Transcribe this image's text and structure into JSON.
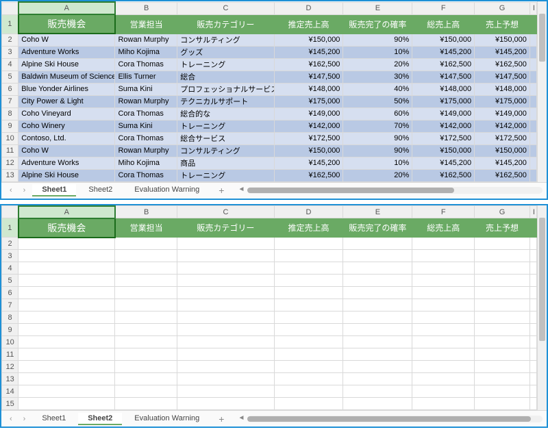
{
  "columns": [
    "A",
    "B",
    "C",
    "D",
    "E",
    "F",
    "G",
    "I"
  ],
  "headers": {
    "A": "販売機会",
    "B": "営業担当",
    "C": "販売カテゴリー",
    "D": "推定売上高",
    "E": "販売完了の確率",
    "F": "総売上高",
    "G": "売上予想"
  },
  "rows": [
    {
      "n": 2,
      "a": "Coho W",
      "b": "Rowan Murphy",
      "c": "コンサルティング",
      "d": "¥150,000",
      "e": "90%",
      "f": "¥150,000",
      "g": "¥150,000"
    },
    {
      "n": 3,
      "a": "Adventure Works",
      "b": "Miho Kojima",
      "c": "グッズ",
      "d": "¥145,200",
      "e": "10%",
      "f": "¥145,200",
      "g": "¥145,200"
    },
    {
      "n": 4,
      "a": "Alpine Ski House",
      "b": "Cora Thomas",
      "c": "トレーニング",
      "d": "¥162,500",
      "e": "20%",
      "f": "¥162,500",
      "g": "¥162,500"
    },
    {
      "n": 5,
      "a": "Baldwin Museum of Science",
      "b": "Ellis Turner",
      "c": "総合",
      "d": "¥147,500",
      "e": "30%",
      "f": "¥147,500",
      "g": "¥147,500"
    },
    {
      "n": 6,
      "a": "Blue Yonder Airlines",
      "b": "Suma Kini",
      "c": "プロフェッショナルサービス",
      "d": "¥148,000",
      "e": "40%",
      "f": "¥148,000",
      "g": "¥148,000"
    },
    {
      "n": 7,
      "a": "City Power & Light",
      "b": "Rowan Murphy",
      "c": "テクニカルサポート",
      "d": "¥175,000",
      "e": "50%",
      "f": "¥175,000",
      "g": "¥175,000"
    },
    {
      "n": 8,
      "a": "Coho Vineyard",
      "b": "Cora Thomas",
      "c": "総合的な",
      "d": "¥149,000",
      "e": "60%",
      "f": "¥149,000",
      "g": "¥149,000"
    },
    {
      "n": 9,
      "a": "Coho Winery",
      "b": "Suma Kini",
      "c": "トレーニング",
      "d": "¥142,000",
      "e": "70%",
      "f": "¥142,000",
      "g": "¥142,000"
    },
    {
      "n": 10,
      "a": "Contoso, Ltd.",
      "b": "Cora Thomas",
      "c": "総合サービス",
      "d": "¥172,500",
      "e": "90%",
      "f": "¥172,500",
      "g": "¥172,500"
    },
    {
      "n": 11,
      "a": "Coho W",
      "b": "Rowan Murphy",
      "c": "コンサルティング",
      "d": "¥150,000",
      "e": "90%",
      "f": "¥150,000",
      "g": "¥150,000"
    },
    {
      "n": 12,
      "a": "Adventure Works",
      "b": "Miho Kojima",
      "c": "商品",
      "d": "¥145,200",
      "e": "10%",
      "f": "¥145,200",
      "g": "¥145,200"
    },
    {
      "n": 13,
      "a": "Alpine Ski House",
      "b": "Cora Thomas",
      "c": "トレーニング",
      "d": "¥162,500",
      "e": "20%",
      "f": "¥162,500",
      "g": "¥162,500"
    }
  ],
  "pane1": {
    "activeTab": "Sheet1",
    "tabs": [
      "Sheet1",
      "Sheet2",
      "Evaluation Warning"
    ],
    "emptyRows": [],
    "hthumbWidth": "70%"
  },
  "pane2": {
    "activeTab": "Sheet2",
    "tabs": [
      "Sheet1",
      "Sheet2",
      "Evaluation Warning"
    ],
    "emptyRows": [
      2,
      3,
      4,
      5,
      6,
      7,
      8,
      9,
      10,
      11,
      12,
      13,
      14,
      15
    ],
    "hthumbWidth": "96%"
  },
  "nav": {
    "prev": "‹",
    "next": "›",
    "add": "+",
    "hprev": "◄",
    "hnext": ""
  }
}
